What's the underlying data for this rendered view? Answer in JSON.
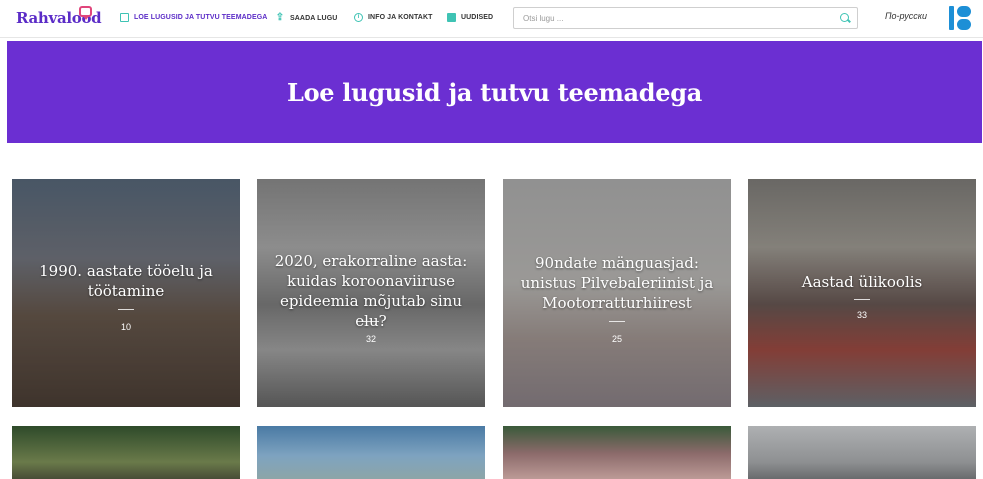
{
  "header": {
    "logo_text": "Rahvalood",
    "nav": [
      {
        "label": "LOE LUGUSID JA TUTVU TEEMADEGA",
        "icon": "book-icon",
        "active": true
      },
      {
        "label": "SAADA LUGU",
        "icon": "upload-icon",
        "active": false
      },
      {
        "label": "INFO JA KONTAKT",
        "icon": "info-icon",
        "active": false
      },
      {
        "label": "UUDISED",
        "icon": "news-icon",
        "active": false
      }
    ],
    "search": {
      "placeholder": "Otsi lugu ...",
      "icon": "search-icon"
    },
    "language": "По-русски",
    "partner_logo": "err-logo"
  },
  "hero": {
    "title": "Loe lugusid ja tutvu teemadega"
  },
  "cards": [
    {
      "title": "1990. aastate tööelu ja töötamine",
      "count": "10"
    },
    {
      "title": "2020, erakorraline aasta: kuidas koroonaviiruse epideemia mõjutab sinu elu?",
      "count": "32"
    },
    {
      "title": "90ndate mänguasjad: unistus Pilvebaleriinist ja Mootorratturhiirest",
      "count": "25"
    },
    {
      "title": "Aastad ülikoolis",
      "count": "33"
    }
  ],
  "colors": {
    "accent": "#6b2fd2",
    "logo": "#5b2cc7",
    "icon": "#3fc3b4",
    "partner": "#1d8fd6"
  }
}
